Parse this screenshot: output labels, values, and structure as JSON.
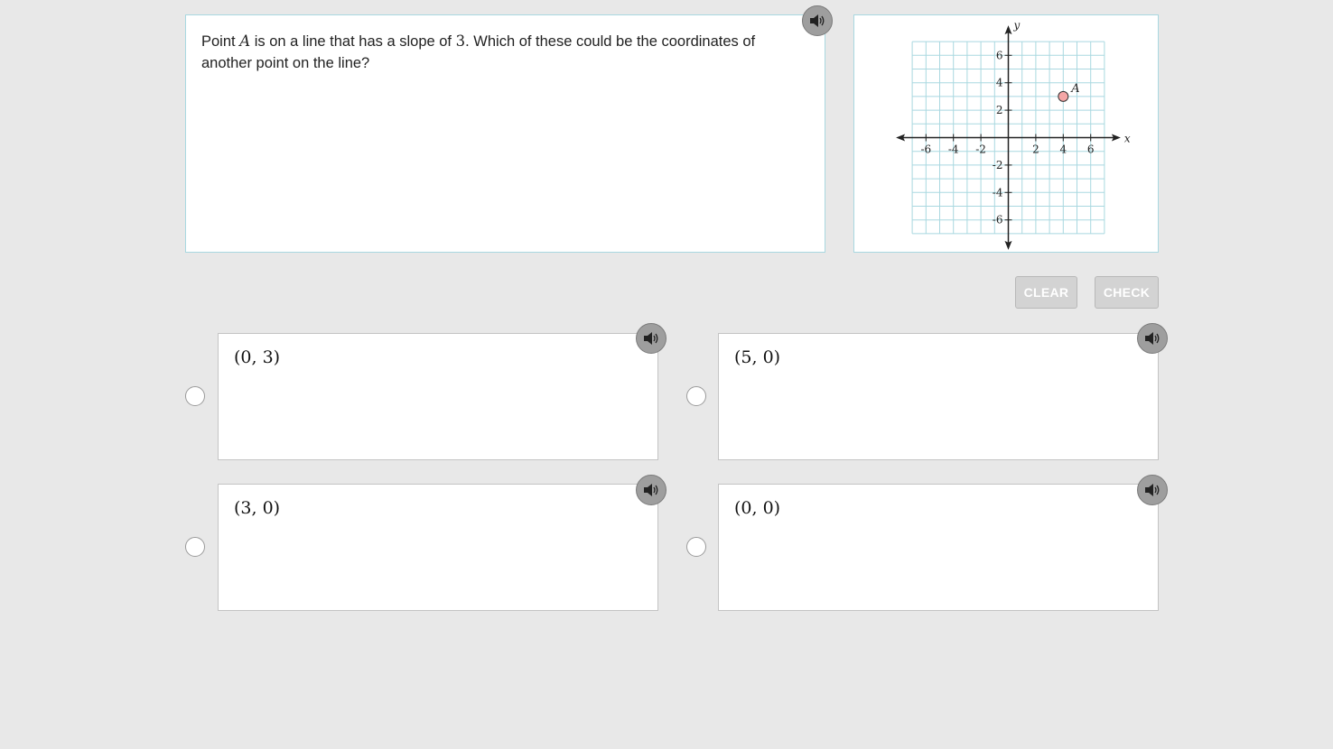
{
  "question": {
    "text_before_point": "Point ",
    "point_name": "A",
    "text_mid": " is on a line that has a slope of ",
    "slope": "3",
    "text_after": ". Which of these could be the coordinates of another point on the line?"
  },
  "graph": {
    "x_axis_label": "x",
    "y_axis_label": "y",
    "x_ticks": [
      -6,
      -4,
      -2,
      2,
      4,
      6
    ],
    "y_ticks": [
      6,
      4,
      2,
      -2,
      -4,
      -6
    ],
    "x_tick_labels": [
      "-6",
      "-4",
      "-2",
      "2",
      "4",
      "6"
    ],
    "y_tick_labels": [
      "6",
      "4",
      "2",
      "-2",
      "-4",
      "-6"
    ],
    "range": [
      -7,
      7
    ],
    "grid": true,
    "point": {
      "label": "A",
      "x": 4,
      "y": 3,
      "color": "#f4a6a6"
    }
  },
  "buttons": {
    "clear": "CLEAR",
    "check": "CHECK"
  },
  "choices": [
    {
      "label": "(0, 3)"
    },
    {
      "label": "(5, 0)"
    },
    {
      "label": "(3, 0)"
    },
    {
      "label": "(0, 0)"
    }
  ],
  "colors": {
    "panel_border": "#a9d8e0",
    "grid": "#a9d8e0",
    "audio_button": "#9e9e9e",
    "disabled_button": "#d3d3d3"
  }
}
